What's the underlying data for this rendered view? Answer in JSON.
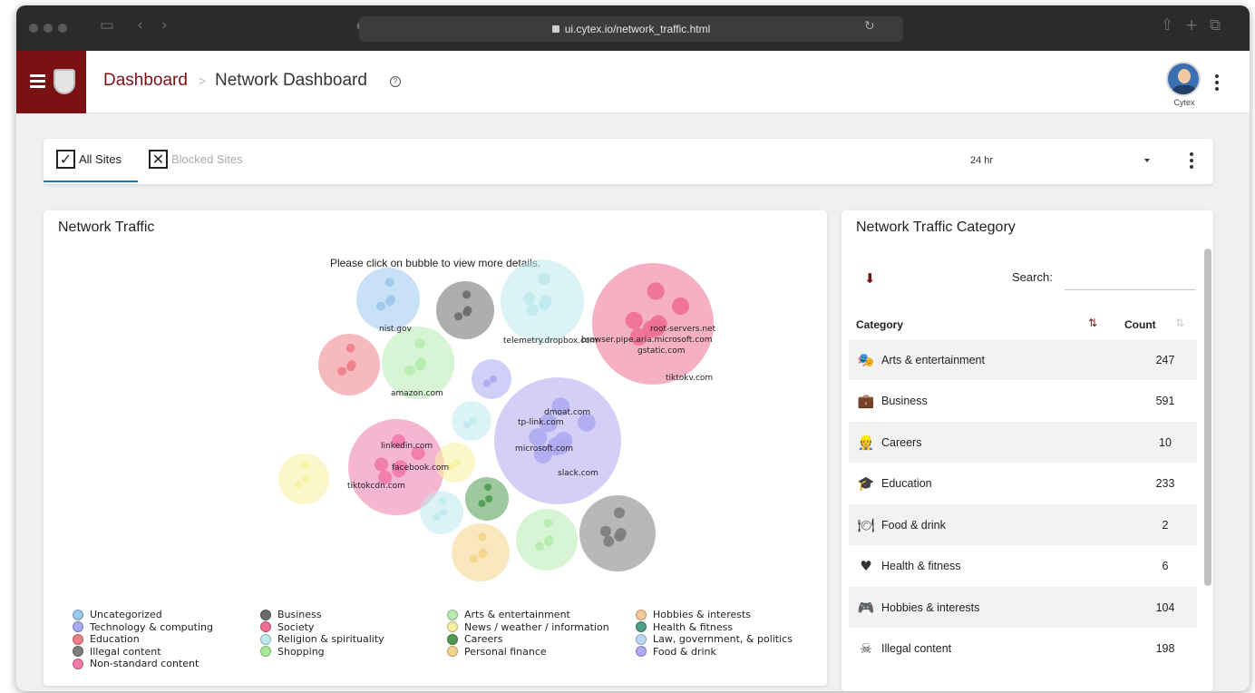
{
  "browser": {
    "url": "ui.cytex.io/network_traffic.html"
  },
  "header": {
    "breadcrumb_root": "Dashboard",
    "breadcrumb_separator": ">",
    "breadcrumb_current": "Network Dashboard",
    "user_name": "Cytex",
    "brand_color": "#7a1214"
  },
  "tabs": {
    "all_sites": "All Sites",
    "blocked_sites": "Blocked Sites",
    "time_range": "24 hr"
  },
  "traffic": {
    "title": "Network Traffic",
    "hint": "Please click on bubble to view more details.",
    "domain_labels": [
      "nist.gov",
      "telemetry.dropbox.com",
      "browser.pipe.aria.microsoft.com",
      "root-servers.net",
      "gstatic.com",
      "tiktokv.com",
      "amazon.com",
      "dmoat.com",
      "tp-link.com",
      "microsoft.com",
      "slack.com",
      "linkedin.com",
      "facebook.com",
      "tiktokcdn.com"
    ],
    "legend": [
      {
        "label": "Uncategorized",
        "color": "#9dc8ee"
      },
      {
        "label": "Technology & computing",
        "color": "#a8a8f0"
      },
      {
        "label": "Education",
        "color": "#ee7f88"
      },
      {
        "label": "Illegal content",
        "color": "#7d7d7d"
      },
      {
        "label": "Non-standard content",
        "color": "#f07aa8"
      },
      {
        "label": "Business",
        "color": "#6b6b6b"
      },
      {
        "label": "Society",
        "color": "#ef6f93"
      },
      {
        "label": "Religion & spirituality",
        "color": "#bfeaee"
      },
      {
        "label": "Shopping",
        "color": "#a8ea9a"
      },
      {
        "label": "Arts & entertainment",
        "color": "#b6ecb0"
      },
      {
        "label": "News / weather / information",
        "color": "#f6f0a0"
      },
      {
        "label": "Careers",
        "color": "#4f9a4f"
      },
      {
        "label": "Personal finance",
        "color": "#f4d68a"
      },
      {
        "label": "Hobbies & interests",
        "color": "#f6c99a"
      },
      {
        "label": "Health & fitness",
        "color": "#4f9e8a"
      },
      {
        "label": "Law, government, & politics",
        "color": "#b8d8f4"
      },
      {
        "label": "Food & drink",
        "color": "#b0a8f0"
      }
    ]
  },
  "category_table": {
    "title": "Network Traffic Category",
    "search_label": "Search:",
    "search_value": "",
    "col_category": "Category",
    "col_count": "Count",
    "rows": [
      {
        "category": "Arts & entertainment",
        "count": "247",
        "icon": "theater-masks-icon"
      },
      {
        "category": "Business",
        "count": "591",
        "icon": "briefcase-icon"
      },
      {
        "category": "Careers",
        "count": "10",
        "icon": "worker-icon"
      },
      {
        "category": "Education",
        "count": "233",
        "icon": "certificate-icon"
      },
      {
        "category": "Food & drink",
        "count": "2",
        "icon": "food-drink-icon"
      },
      {
        "category": "Health & fitness",
        "count": "6",
        "icon": "heartbeat-icon"
      },
      {
        "category": "Hobbies & interests",
        "count": "104",
        "icon": "gamepad-icon"
      },
      {
        "category": "Illegal content",
        "count": "198",
        "icon": "skull-icon"
      }
    ]
  }
}
